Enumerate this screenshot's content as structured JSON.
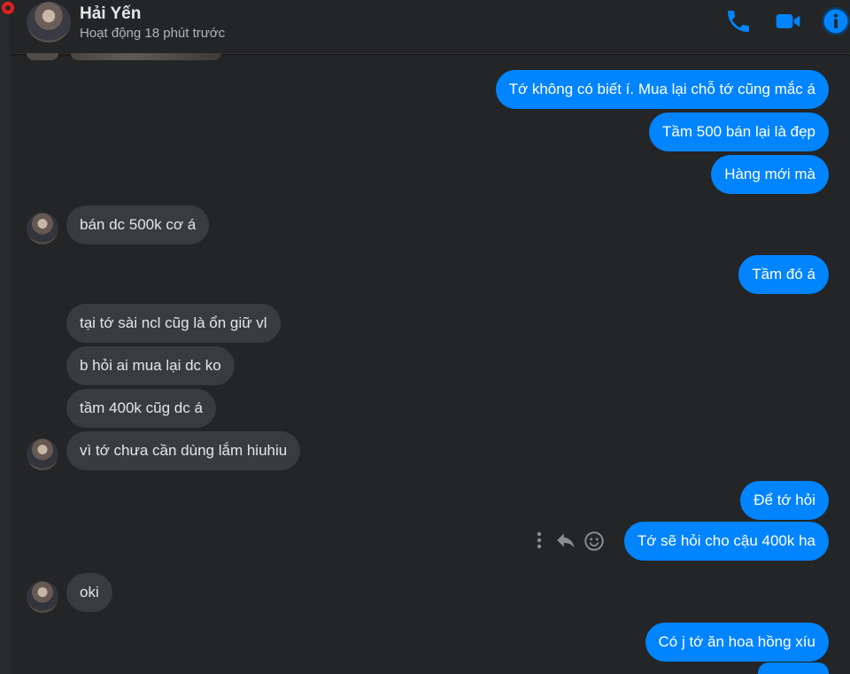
{
  "contact": {
    "name": "Hải Yến",
    "status": "Hoạt động 18 phút trước"
  },
  "header_icons": [
    "phone-icon",
    "video-camera-icon",
    "info-icon"
  ],
  "colors": {
    "accent": "#0084ff",
    "background": "#242526",
    "incoming_bubble": "#3a3b3c",
    "presence_ring": "#e41e1e"
  },
  "messages": [
    {
      "from": "me",
      "text": "Tớ không có biết í. Mua lại chỗ tớ cũng mắc á"
    },
    {
      "from": "me",
      "text": "Tầm 500 bán lại là đẹp"
    },
    {
      "from": "me",
      "text": "Hàng mới mà"
    },
    {
      "from": "them",
      "text": "bán dc 500k cơ á"
    },
    {
      "from": "me",
      "text": "Tầm đó á"
    },
    {
      "from": "them",
      "text": "tại tớ sài ncl cũg là ổn giữ vl"
    },
    {
      "from": "them",
      "text": "b hỏi ai mua lại dc ko"
    },
    {
      "from": "them",
      "text": "tầm 400k cũg dc á"
    },
    {
      "from": "them",
      "text": "vì tớ chưa cần dùng lắm hiuhiu"
    },
    {
      "from": "me",
      "text": "Để tớ hỏi"
    },
    {
      "from": "me",
      "text": "Tớ sẽ hỏi cho cậu 400k ha"
    },
    {
      "from": "them",
      "text": "oki"
    },
    {
      "from": "me",
      "text": "Có j tớ ăn hoa hồng xíu"
    }
  ],
  "message_actions": [
    "more-options-icon",
    "reply-icon",
    "react-emoji-icon"
  ]
}
